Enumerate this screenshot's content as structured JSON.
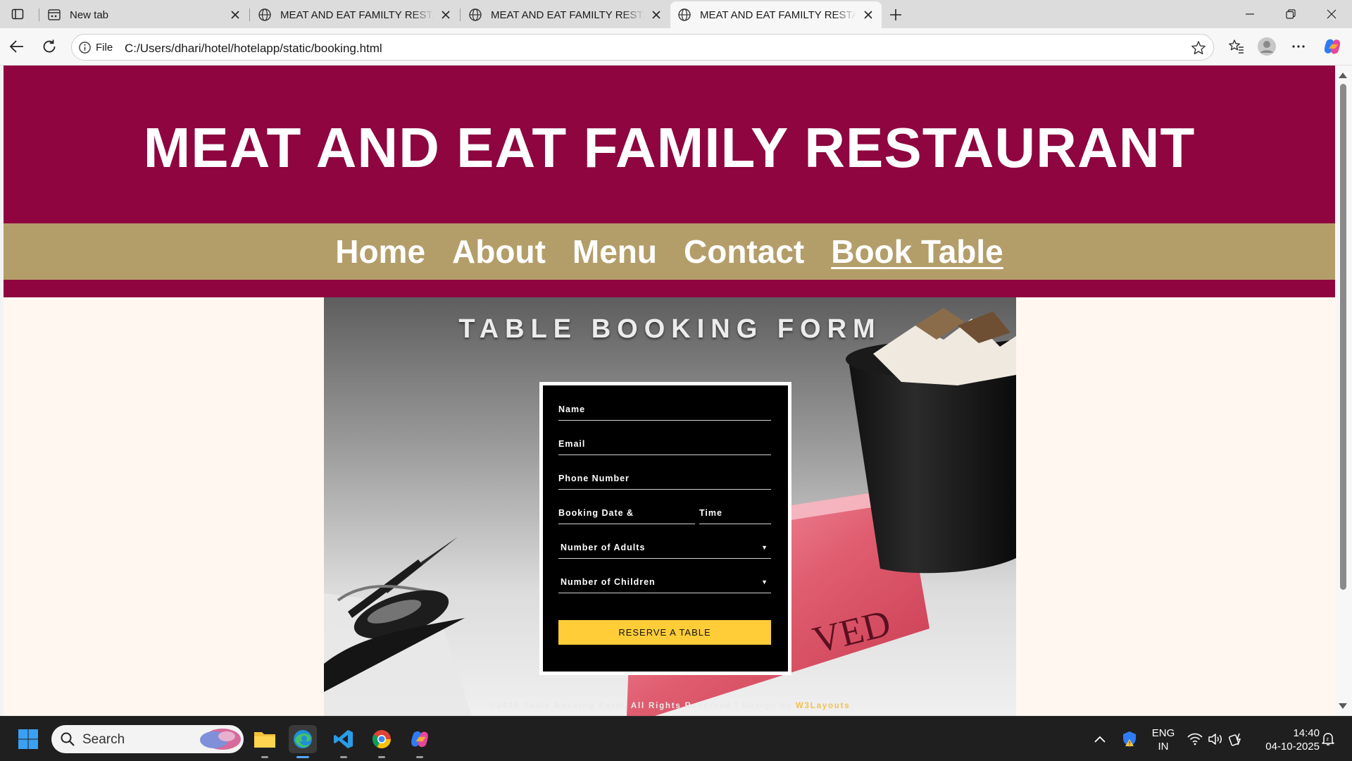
{
  "browser": {
    "tabs": [
      {
        "title": "New tab",
        "active": false,
        "favicon": "new-tab-icon"
      },
      {
        "title": "MEAT AND EAT FAMILTY RESTAURANT",
        "active": false,
        "favicon": "globe-icon"
      },
      {
        "title": "MEAT AND EAT FAMILTY RESTAURANT",
        "active": false,
        "favicon": "globe-icon"
      },
      {
        "title": "MEAT AND EAT FAMILTY RESTAURANT",
        "active": true,
        "favicon": "globe-icon"
      }
    ],
    "address": {
      "scheme_label": "File",
      "url": "C:/Users/dhari/hotel/hotelapp/static/booking.html"
    }
  },
  "site": {
    "title": "MEAT AND EAT FAMILY RESTAURANT",
    "nav": [
      "Home",
      "About",
      "Menu",
      "Contact",
      "Book Table"
    ],
    "current_nav": "Book Table",
    "colors": {
      "header": "#8e0540",
      "nav": "#b39e6a",
      "page_bg": "#fff7f0",
      "button": "#fecd38"
    }
  },
  "booking": {
    "heading": "TABLE BOOKING FORM",
    "fields": {
      "name": "Name",
      "email": "Email",
      "phone": "Phone Number",
      "date": "Booking Date &",
      "time": "Time",
      "adults": "Number of Adults",
      "children": "Number of Children"
    },
    "submit": "RESERVE A TABLE",
    "footer_text": "©2018 Table Booking Form. All Rights Reserved | Design by ",
    "footer_link": "W3Layouts"
  },
  "taskbar": {
    "search_placeholder": "Search",
    "lang_line1": "ENG",
    "lang_line2": "IN",
    "time": "14:40",
    "date": "04-10-2025",
    "pinned": [
      "windows-start-icon",
      "file-explorer-icon",
      "edge-icon",
      "vscode-icon",
      "chrome-icon",
      "copilot-icon"
    ]
  }
}
